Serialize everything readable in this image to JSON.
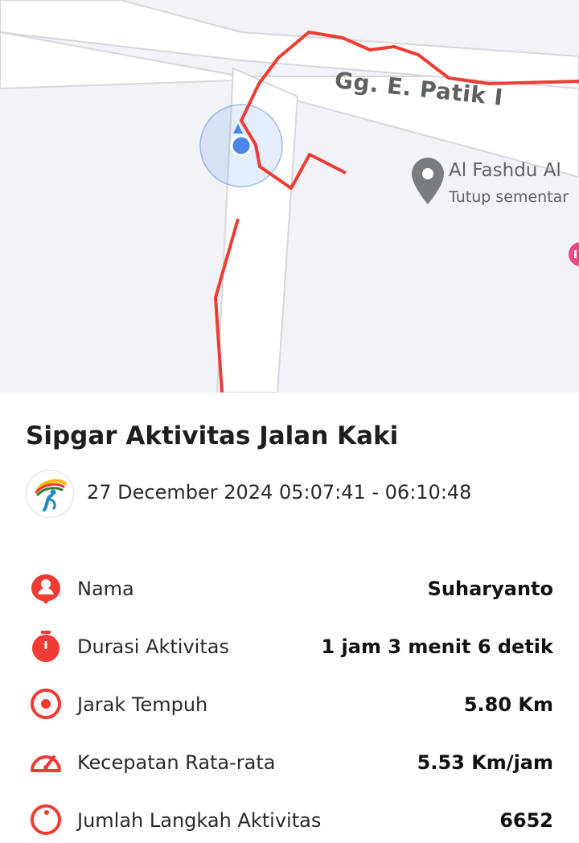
{
  "map": {
    "street_label": "Gg. E. Patik I",
    "poi": {
      "name": "Al Fashdu Al",
      "status": "Tutup sementar"
    },
    "colors": {
      "route": "#ee3b33",
      "location": "#4a86e8",
      "poi_pin": "#7a7d80"
    }
  },
  "activity": {
    "title": "Sipgar Aktivitas Jalan Kaki",
    "datetime": "27 December 2024 05:07:41 - 06:10:48",
    "rows": [
      {
        "icon": "user-pin-icon",
        "label": "Nama",
        "value": "Suharyanto"
      },
      {
        "icon": "stopwatch-icon",
        "label": "Durasi Aktivitas",
        "value": "1 jam 3 menit 6 detik"
      },
      {
        "icon": "target-icon",
        "label": "Jarak Tempuh",
        "value": "5.80 Km"
      },
      {
        "icon": "speedometer-icon",
        "label": "Kecepatan Rata-rata",
        "value": "5.53 Km/jam"
      },
      {
        "icon": "steps-icon",
        "label": "Jumlah Langkah Aktivitas",
        "value": "6652"
      }
    ]
  },
  "accent_color": "#ee3b33"
}
